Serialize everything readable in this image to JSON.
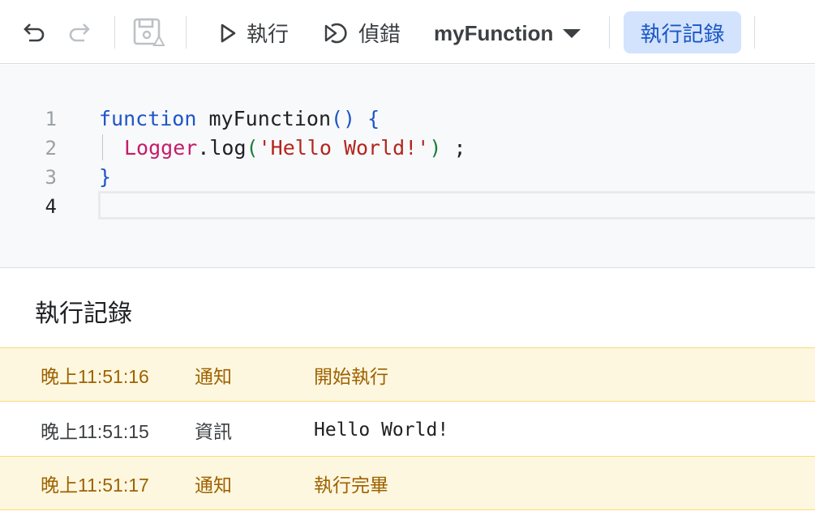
{
  "toolbar": {
    "undo_icon": "undo-icon",
    "redo_icon": "redo-icon",
    "save_icon": "save-to-drive-icon",
    "run_label": "執行",
    "debug_label": "偵錯",
    "function_name": "myFunction",
    "execution_log_label": "執行記錄",
    "accent_color": "#d3e3fd"
  },
  "editor": {
    "lines": [
      {
        "number": "1",
        "parts": [
          "function",
          "myFunction",
          "()",
          "{"
        ]
      },
      {
        "number": "2",
        "parts": [
          "Logger",
          ".log",
          "(",
          "'Hello World!'",
          ")",
          ";"
        ]
      },
      {
        "number": "3",
        "parts": [
          "}"
        ]
      },
      {
        "number": "4",
        "parts": []
      }
    ]
  },
  "log": {
    "title": "執行記錄",
    "entries": [
      {
        "time": "晚上11:51:16",
        "level": "通知",
        "message": "開始執行",
        "type": "notice"
      },
      {
        "time": "晚上11:51:15",
        "level": "資訊",
        "message": "Hello World!",
        "type": "info"
      },
      {
        "time": "晚上11:51:17",
        "level": "通知",
        "message": "執行完畢",
        "type": "notice"
      }
    ],
    "notice_color": "#fef7e0"
  }
}
